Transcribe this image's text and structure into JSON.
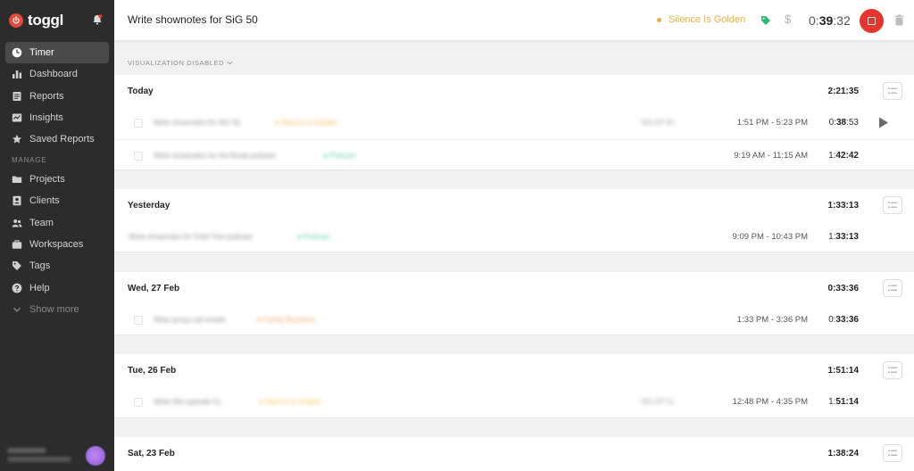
{
  "app": {
    "logo_text": "toggl"
  },
  "sidebar": {
    "items": [
      {
        "label": "Timer",
        "icon": "clock-icon",
        "active": true
      },
      {
        "label": "Dashboard",
        "icon": "bar-chart-icon"
      },
      {
        "label": "Reports",
        "icon": "document-icon"
      },
      {
        "label": "Insights",
        "icon": "insights-icon"
      },
      {
        "label": "Saved Reports",
        "icon": "star-icon"
      }
    ],
    "manage_label": "MANAGE",
    "manage_items": [
      {
        "label": "Projects",
        "icon": "folder-icon"
      },
      {
        "label": "Clients",
        "icon": "contact-card-icon"
      },
      {
        "label": "Team",
        "icon": "team-icon"
      },
      {
        "label": "Workspaces",
        "icon": "briefcase-icon"
      },
      {
        "label": "Tags",
        "icon": "tag-icon"
      },
      {
        "label": "Help",
        "icon": "help-icon"
      }
    ],
    "show_more_label": "Show more"
  },
  "topbar": {
    "description": "Write shownotes for SiG 50",
    "project": "Silence Is Golden",
    "project_color": "#e5b03a",
    "billable_symbol": "$",
    "timer_prefix": "0:",
    "timer_bold": "39",
    "timer_suffix": ":32"
  },
  "visualization_label": "VISUALIZATION DISABLED",
  "days": [
    {
      "title": "Today",
      "total": "2:21:35",
      "entries": [
        {
          "range": "1:51 PM - 5:23 PM",
          "dur_prefix": "0:",
          "dur_bold": "38",
          "dur_suffix": ":53",
          "project_color": "#f2b24a"
        },
        {
          "range": "9:19 AM - 11:15 AM",
          "dur_prefix": "1:",
          "dur_bold": "42:42",
          "dur_suffix": "",
          "project_color": "#4fcf9a"
        }
      ]
    },
    {
      "title": "Yesterday",
      "total": "1:33:13",
      "entries": [
        {
          "range": "9:09 PM - 10:43 PM",
          "dur_prefix": "1:",
          "dur_bold": "33:13",
          "dur_suffix": "",
          "project_color": "#4fcf9a"
        }
      ]
    },
    {
      "title": "Wed, 27 Feb",
      "total": "0:33:36",
      "entries": [
        {
          "range": "1:33 PM - 3:36 PM",
          "dur_prefix": "0:",
          "dur_bold": "33:36",
          "dur_suffix": "",
          "project_color": "#f19a54"
        }
      ]
    },
    {
      "title": "Tue, 26 Feb",
      "total": "1:51:14",
      "entries": [
        {
          "range": "12:48 PM - 4:35 PM",
          "dur_prefix": "1:",
          "dur_bold": "51:14",
          "dur_suffix": "",
          "project_color": "#f2c24a"
        }
      ]
    },
    {
      "title": "Sat, 23 Feb",
      "total": "1:38:24",
      "entries": []
    }
  ]
}
